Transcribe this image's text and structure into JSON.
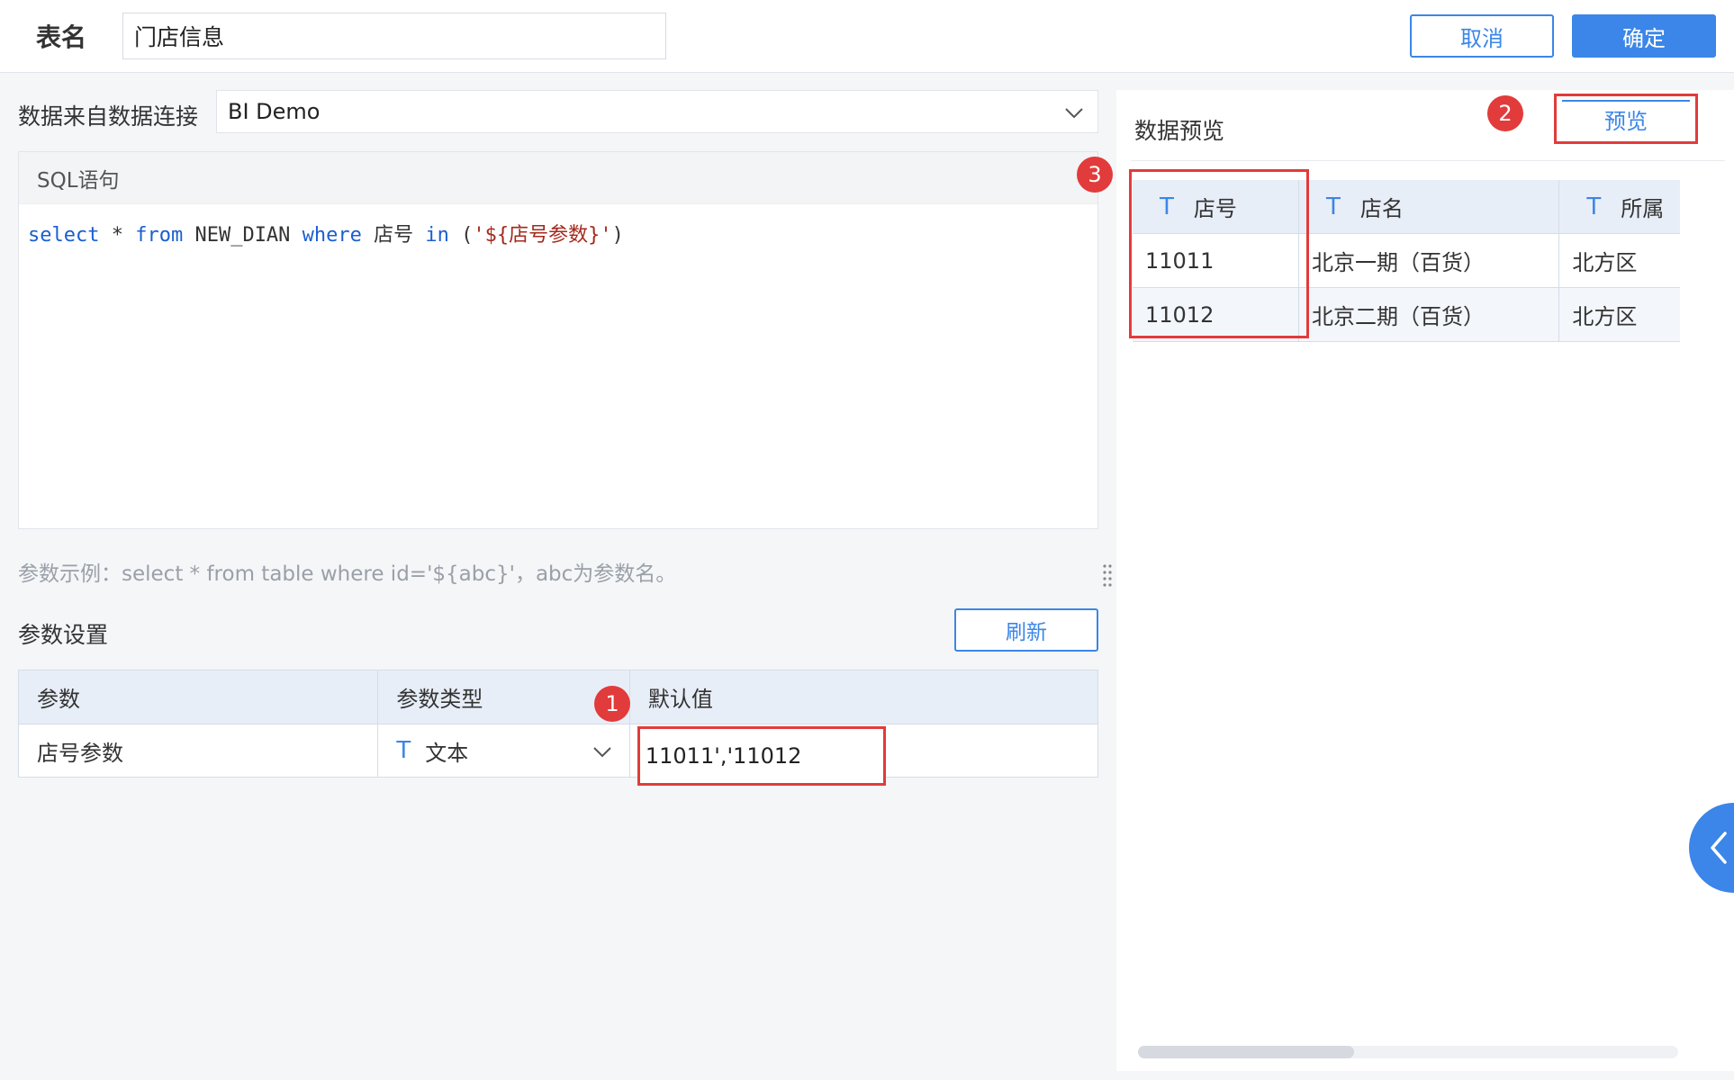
{
  "header": {
    "table_name_label": "表名",
    "table_name_value": "门店信息",
    "cancel_label": "取消",
    "confirm_label": "确定"
  },
  "source": {
    "label": "数据来自数据连接",
    "selected": "BI Demo"
  },
  "sql": {
    "header": "SQL语句",
    "tokens": {
      "select": "select",
      "star": " * ",
      "from": "from",
      "table": " NEW_DIAN ",
      "where": "where",
      "field": " 店号 ",
      "in": "in",
      "open": " (",
      "param": "'${店号参数}'",
      "close": ")"
    }
  },
  "hint": "参数示例：select * from table where id='${abc}'，abc为参数名。",
  "params": {
    "title": "参数设置",
    "refresh_label": "刷新",
    "columns": [
      "参数",
      "参数类型",
      "默认值"
    ],
    "rows": [
      {
        "name": "店号参数",
        "type_icon": "T",
        "type": "文本",
        "default": "11011','11012"
      }
    ]
  },
  "preview": {
    "title": "数据预览",
    "button_label": "预览",
    "columns": [
      {
        "icon": "T",
        "name": "店号"
      },
      {
        "icon": "T",
        "name": "店名"
      },
      {
        "icon": "T",
        "name": "所属"
      }
    ],
    "rows": [
      [
        "11011",
        "北京一期（百货）",
        "北方区"
      ],
      [
        "11012",
        "北京二期（百货）",
        "北方区"
      ]
    ]
  },
  "annotations": {
    "badge1": "1",
    "badge2": "2",
    "badge3": "3"
  },
  "icons": {
    "source_dropdown": "chevron-down-icon",
    "type_dropdown": "chevron-down-icon",
    "text_type": "text-type-icon",
    "drag_handle": "drag-handle-icon",
    "collapse": "chevron-left-icon"
  },
  "colors": {
    "accent": "#3b86e8",
    "highlight": "#e23b3b",
    "table_header": "#e8eef7"
  }
}
